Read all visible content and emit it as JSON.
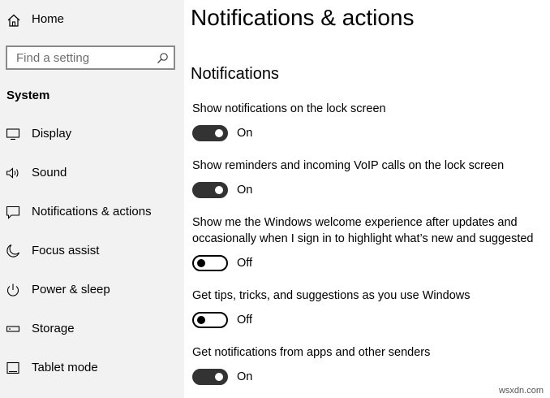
{
  "sidebar": {
    "home_label": "Home",
    "search_placeholder": "Find a setting",
    "section_title": "System",
    "items": [
      {
        "label": "Display",
        "icon": "monitor-icon"
      },
      {
        "label": "Sound",
        "icon": "speaker-icon"
      },
      {
        "label": "Notifications & actions",
        "icon": "notification-icon"
      },
      {
        "label": "Focus assist",
        "icon": "moon-icon"
      },
      {
        "label": "Power & sleep",
        "icon": "power-icon"
      },
      {
        "label": "Storage",
        "icon": "storage-icon"
      },
      {
        "label": "Tablet mode",
        "icon": "tablet-icon"
      }
    ]
  },
  "main": {
    "title": "Notifications & actions",
    "subheading": "Notifications",
    "settings": [
      {
        "label": "Show notifications on the lock screen",
        "state": "On",
        "enabled": true
      },
      {
        "label": "Show reminders and incoming VoIP calls on the lock screen",
        "state": "On",
        "enabled": true
      },
      {
        "label": "Show me the Windows welcome experience after updates and occasionally when I sign in to highlight what’s new and suggested",
        "state": "Off",
        "enabled": false
      },
      {
        "label": "Get tips, tricks, and suggestions as you use Windows",
        "state": "Off",
        "enabled": false
      },
      {
        "label": "Get notifications from apps and other senders",
        "state": "On",
        "enabled": true
      }
    ]
  },
  "watermark": "wsxdn.com"
}
